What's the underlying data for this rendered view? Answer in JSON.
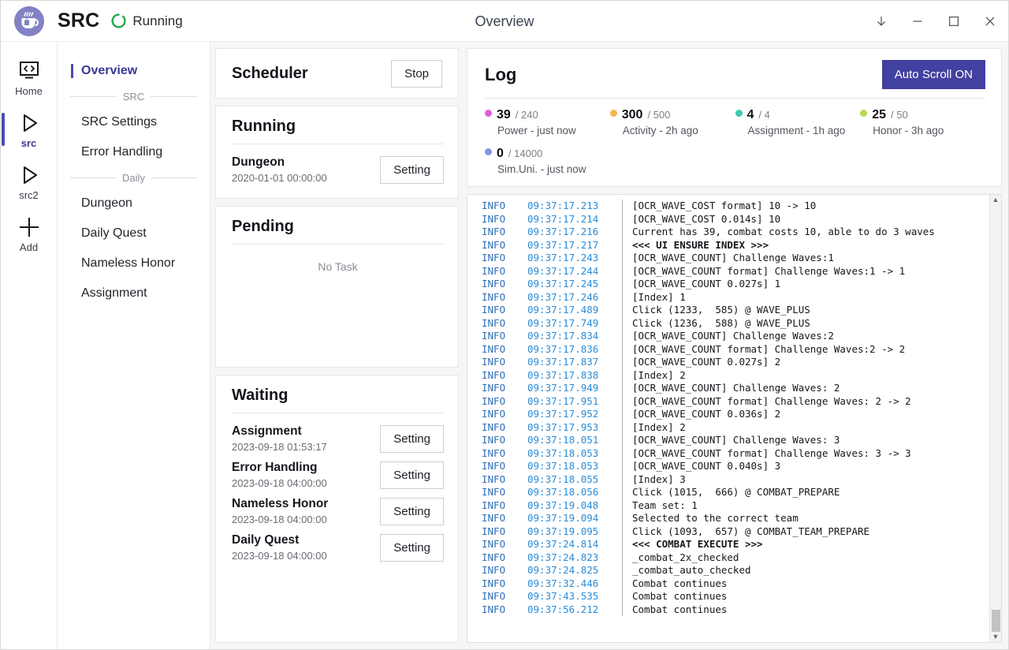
{
  "titlebar": {
    "logo_icon": "coffee-cup-icon",
    "brand": "SRC",
    "spinner_icon": "running-spinner-icon",
    "status": "Running",
    "window_title": "Overview",
    "controls": [
      {
        "name": "download-button",
        "glyph": "↓"
      },
      {
        "name": "minimize-button",
        "glyph": "−"
      },
      {
        "name": "maximize-button",
        "glyph": "□"
      },
      {
        "name": "close-button",
        "glyph": "✕"
      }
    ]
  },
  "rail": {
    "items": [
      {
        "label": "Home",
        "icon": "code-screen-icon",
        "active": false
      },
      {
        "label": "src",
        "icon": "play-triangle-icon",
        "active": true
      },
      {
        "label": "src2",
        "icon": "play-triangle-icon",
        "active": false
      },
      {
        "label": "Add",
        "icon": "plus-icon",
        "active": false
      }
    ]
  },
  "nav": {
    "overview": "Overview",
    "group_src": "SRC",
    "group_daily": "Daily",
    "src_items": [
      "SRC Settings",
      "Error Handling"
    ],
    "daily_items": [
      "Dungeon",
      "Daily Quest",
      "Nameless Honor",
      "Assignment"
    ]
  },
  "scheduler": {
    "title": "Scheduler",
    "stop_label": "Stop"
  },
  "running": {
    "title": "Running",
    "tasks": [
      {
        "name": "Dungeon",
        "time": "2020-01-01 00:00:00",
        "button": "Setting"
      }
    ]
  },
  "pending": {
    "title": "Pending",
    "empty": "No Task"
  },
  "waiting": {
    "title": "Waiting",
    "tasks": [
      {
        "name": "Assignment",
        "time": "2023-09-18 01:53:17",
        "button": "Setting"
      },
      {
        "name": "Error Handling",
        "time": "2023-09-18 04:00:00",
        "button": "Setting"
      },
      {
        "name": "Nameless Honor",
        "time": "2023-09-18 04:00:00",
        "button": "Setting"
      },
      {
        "name": "Daily Quest",
        "time": "2023-09-18 04:00:00",
        "button": "Setting"
      }
    ]
  },
  "log": {
    "title": "Log",
    "auto_scroll_label": "Auto Scroll ON",
    "stats": [
      {
        "current": "39",
        "max": "/ 240",
        "label": "Power - just now",
        "color": "#e060d8"
      },
      {
        "current": "300",
        "max": "/ 500",
        "label": "Activity - 2h ago",
        "color": "#f4b350"
      },
      {
        "current": "4",
        "max": "/ 4",
        "label": "Assignment - 1h ago",
        "color": "#3ec9b0"
      },
      {
        "current": "25",
        "max": "/ 50",
        "label": "Honor - 3h ago",
        "color": "#b4dd4a"
      },
      {
        "current": "0",
        "max": "/ 14000",
        "label": "Sim.Uni. - just now",
        "color": "#7b9ae0"
      }
    ],
    "scrollbar": {
      "up": "▲",
      "down": "▼"
    },
    "lines": [
      {
        "level": "INFO",
        "time": "09:37:17.213",
        "msg": "[OCR_WAVE_COST format] 10 -> 10",
        "bold": false
      },
      {
        "level": "INFO",
        "time": "09:37:17.214",
        "msg": "[OCR_WAVE_COST 0.014s] 10",
        "bold": false
      },
      {
        "level": "INFO",
        "time": "09:37:17.216",
        "msg": "Current has 39, combat costs 10, able to do 3 waves",
        "bold": false
      },
      {
        "level": "INFO",
        "time": "09:37:17.217",
        "msg": "<<< UI ENSURE INDEX >>>",
        "bold": true
      },
      {
        "level": "INFO",
        "time": "09:37:17.243",
        "msg": "[OCR_WAVE_COUNT] Challenge Waves:1",
        "bold": false
      },
      {
        "level": "INFO",
        "time": "09:37:17.244",
        "msg": "[OCR_WAVE_COUNT format] Challenge Waves:1 -> 1",
        "bold": false
      },
      {
        "level": "INFO",
        "time": "09:37:17.245",
        "msg": "[OCR_WAVE_COUNT 0.027s] 1",
        "bold": false
      },
      {
        "level": "INFO",
        "time": "09:37:17.246",
        "msg": "[Index] 1",
        "bold": false
      },
      {
        "level": "INFO",
        "time": "09:37:17.489",
        "msg": "Click (1233,  585) @ WAVE_PLUS",
        "bold": false
      },
      {
        "level": "INFO",
        "time": "09:37:17.749",
        "msg": "Click (1236,  588) @ WAVE_PLUS",
        "bold": false
      },
      {
        "level": "INFO",
        "time": "09:37:17.834",
        "msg": "[OCR_WAVE_COUNT] Challenge Waves:2",
        "bold": false
      },
      {
        "level": "INFO",
        "time": "09:37:17.836",
        "msg": "[OCR_WAVE_COUNT format] Challenge Waves:2 -> 2",
        "bold": false
      },
      {
        "level": "INFO",
        "time": "09:37:17.837",
        "msg": "[OCR_WAVE_COUNT 0.027s] 2",
        "bold": false
      },
      {
        "level": "INFO",
        "time": "09:37:17.838",
        "msg": "[Index] 2",
        "bold": false
      },
      {
        "level": "INFO",
        "time": "09:37:17.949",
        "msg": "[OCR_WAVE_COUNT] Challenge Waves: 2",
        "bold": false
      },
      {
        "level": "INFO",
        "time": "09:37:17.951",
        "msg": "[OCR_WAVE_COUNT format] Challenge Waves: 2 -> 2",
        "bold": false
      },
      {
        "level": "INFO",
        "time": "09:37:17.952",
        "msg": "[OCR_WAVE_COUNT 0.036s] 2",
        "bold": false
      },
      {
        "level": "INFO",
        "time": "09:37:17.953",
        "msg": "[Index] 2",
        "bold": false
      },
      {
        "level": "INFO",
        "time": "09:37:18.051",
        "msg": "[OCR_WAVE_COUNT] Challenge Waves: 3",
        "bold": false
      },
      {
        "level": "INFO",
        "time": "09:37:18.053",
        "msg": "[OCR_WAVE_COUNT format] Challenge Waves: 3 -> 3",
        "bold": false
      },
      {
        "level": "INFO",
        "time": "09:37:18.053",
        "msg": "[OCR_WAVE_COUNT 0.040s] 3",
        "bold": false
      },
      {
        "level": "INFO",
        "time": "09:37:18.055",
        "msg": "[Index] 3",
        "bold": false
      },
      {
        "level": "INFO",
        "time": "09:37:18.056",
        "msg": "Click (1015,  666) @ COMBAT_PREPARE",
        "bold": false
      },
      {
        "level": "INFO",
        "time": "09:37:19.048",
        "msg": "Team set: 1",
        "bold": false
      },
      {
        "level": "INFO",
        "time": "09:37:19.094",
        "msg": "Selected to the correct team",
        "bold": false
      },
      {
        "level": "INFO",
        "time": "09:37:19.095",
        "msg": "Click (1093,  657) @ COMBAT_TEAM_PREPARE",
        "bold": false
      },
      {
        "level": "INFO",
        "time": "09:37:24.814",
        "msg": "<<< COMBAT EXECUTE >>>",
        "bold": true
      },
      {
        "level": "INFO",
        "time": "09:37:24.823",
        "msg": "_combat_2x_checked",
        "bold": false
      },
      {
        "level": "INFO",
        "time": "09:37:24.825",
        "msg": "_combat_auto_checked",
        "bold": false
      },
      {
        "level": "INFO",
        "time": "09:37:32.446",
        "msg": "Combat continues",
        "bold": false
      },
      {
        "level": "INFO",
        "time": "09:37:43.535",
        "msg": "Combat continues",
        "bold": false
      },
      {
        "level": "INFO",
        "time": "09:37:56.212",
        "msg": "Combat continues",
        "bold": false
      }
    ]
  }
}
